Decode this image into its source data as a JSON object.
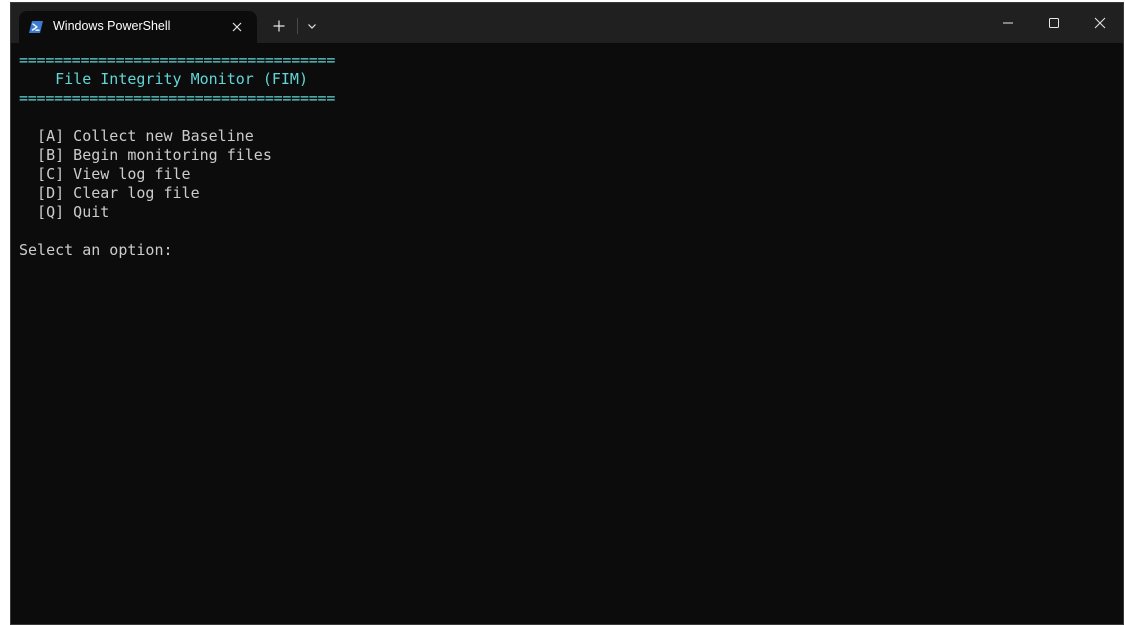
{
  "window": {
    "tab_title": "Windows PowerShell"
  },
  "icons": {
    "tab": "powershell-icon",
    "tab_close": "close-icon",
    "new_tab": "plus-icon",
    "dropdown": "chevron-down-icon",
    "minimize": "minimize-icon",
    "maximize": "maximize-icon",
    "close": "close-icon"
  },
  "colors": {
    "console_bg": "#0c0c0c",
    "text": "#cccccc",
    "accent_cyan": "#61d6d6"
  },
  "console": {
    "rule_top": "====================================",
    "heading": "    File Integrity Monitor (FIM)",
    "rule_bottom": "====================================",
    "menu": [
      "  [A] Collect new Baseline",
      "  [B] Begin monitoring files",
      "  [C] View log file",
      "  [D] Clear log file",
      "  [Q] Quit"
    ],
    "prompt": "Select an option:"
  }
}
